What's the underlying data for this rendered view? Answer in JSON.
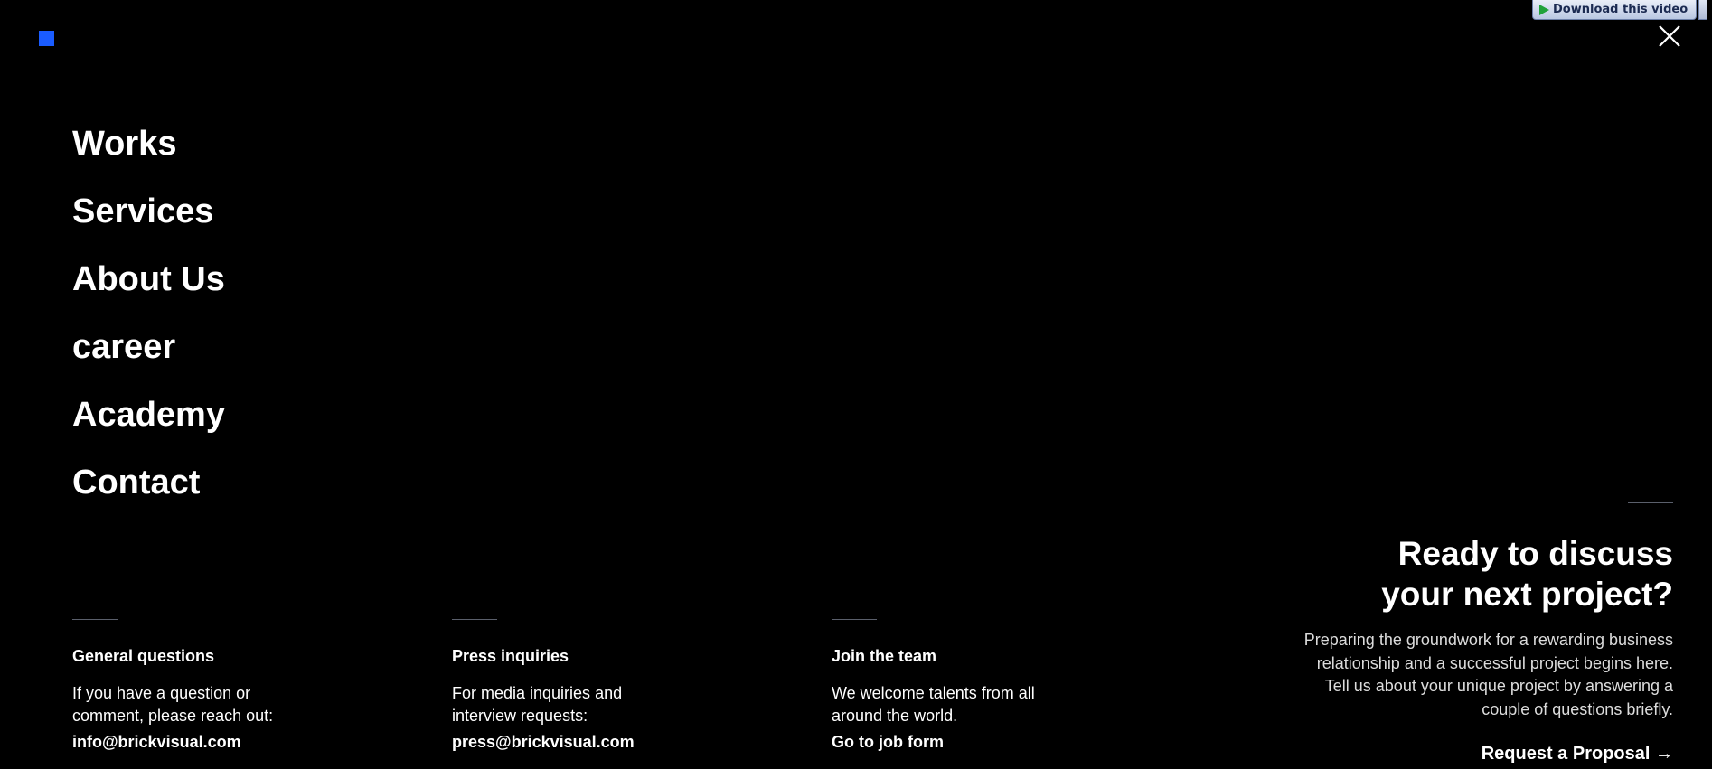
{
  "download_badge": {
    "label": "Download this video"
  },
  "nav": {
    "items": [
      {
        "label": "Works"
      },
      {
        "label": "Services"
      },
      {
        "label": "About Us"
      },
      {
        "label": "career"
      },
      {
        "label": "Academy"
      },
      {
        "label": "Contact"
      }
    ]
  },
  "contacts": [
    {
      "title": "General questions",
      "text_line1": "If you have a question or",
      "text_line2": "comment, please reach out:",
      "link": "info@brickvisual.com"
    },
    {
      "title": "Press inquiries",
      "text_line1": "For media inquiries and",
      "text_line2": "interview requests:",
      "link": "press@brickvisual.com"
    },
    {
      "title": "Join the team",
      "text_line1": "We welcome talents from all",
      "text_line2": "around the world.",
      "link": "Go to job form"
    }
  ],
  "proposal": {
    "title_line1": "Ready to discuss",
    "title_line2": "your next project?",
    "text_line1": "Preparing the groundwork for a rewarding business",
    "text_line2": "relationship and a successful project begins here.",
    "text_line3": "Tell us about your unique project by answering a",
    "text_line4": "couple of questions briefly.",
    "cta": "Request a Proposal →"
  },
  "colors": {
    "background": "#000000",
    "accent": "#1a5cff",
    "text": "#ffffff",
    "rule": "#5a5f6b"
  },
  "icons": {
    "logo": "square-logo-icon",
    "close": "close-icon",
    "play": "play-icon"
  }
}
